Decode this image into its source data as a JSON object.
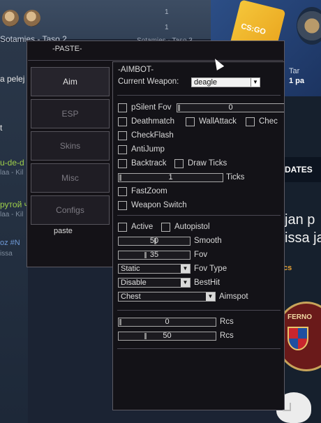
{
  "background": {
    "top_name_left": "Sotamies - Taso 2",
    "top_name_right": "Sotamies - Taso 3",
    "badge_count_1": "1",
    "badge_count_2": "1",
    "left_text_1": "a pelej",
    "left_text_2": "t",
    "left_text_3": "u-de-d",
    "left_text_4": "laa - Kil",
    "left_text_5": "рутой ч",
    "left_text_6": "laa - Kil",
    "left_text_7": "oz #N",
    "left_text_8": "issa",
    "case_label": "CS:GO",
    "right_top_1": "Tar",
    "right_top_2": "1 pa",
    "updates": "PDATES",
    "news_1": "jan p",
    "news_2": "issa ja",
    "news_3": "cs",
    "emblem_text": "FERNO"
  },
  "menu": {
    "title": "-PASTE-",
    "brand": "paste",
    "tabs": [
      {
        "label": "Aim",
        "active": true
      },
      {
        "label": "ESP",
        "active": false
      },
      {
        "label": "Skins",
        "active": false
      },
      {
        "label": "Misc",
        "active": false
      },
      {
        "label": "Configs",
        "active": false
      }
    ]
  },
  "aimbot": {
    "header": "-AIMBOT-",
    "weapon_label": "Current Weapon:",
    "weapon_value": "deagle",
    "psilent_label": "pSilent Fov",
    "psilent_value": "0",
    "deathmatch_label": "Deathmatch",
    "wallattack_label": "WallAttack",
    "chec_label": "Chec",
    "checkflash_label": "CheckFlash",
    "antijump_label": "AntiJump",
    "backtrack_label": "Backtrack",
    "drawticks_label": "Draw Ticks",
    "ticks_value": "1",
    "ticks_label": "Ticks",
    "fastzoom_label": "FastZoom",
    "weaponswitch_label": "Weapon Switch",
    "active_label": "Active",
    "autopistol_label": "Autopistol",
    "smooth_value": "50",
    "smooth_label": "Smooth",
    "fov_value": "35",
    "fov_label": "Fov",
    "fovtype_value": "Static",
    "fovtype_label": "Fov Type",
    "besthit_value": "Disable",
    "besthit_label": "BestHit",
    "aimspot_value": "Chest",
    "aimspot_label": "Aimspot",
    "rcs1_value": "0",
    "rcs1_label": "Rcs",
    "rcs2_value": "50",
    "rcs2_label": "Rcs"
  }
}
